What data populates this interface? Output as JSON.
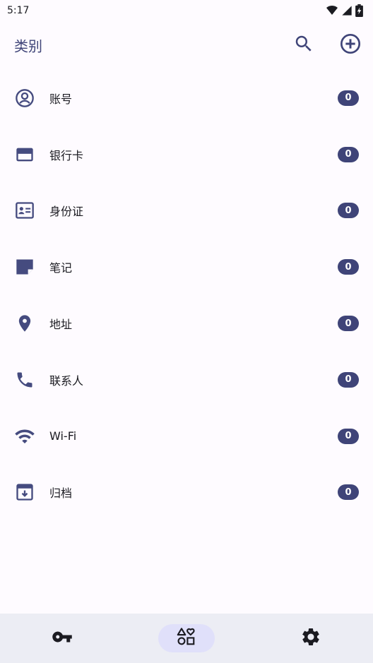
{
  "status_bar": {
    "time": "5:17",
    "icons": [
      "wifi-icon",
      "cellular-signal-icon",
      "battery-charging-icon"
    ]
  },
  "header": {
    "title": "类别",
    "actions": [
      "search-icon",
      "add-circle-icon"
    ]
  },
  "categories": [
    {
      "label": "账号",
      "count": "0",
      "icon": "account-circle-icon"
    },
    {
      "label": "银行卡",
      "count": "0",
      "icon": "credit-card-icon"
    },
    {
      "label": "身份证",
      "count": "0",
      "icon": "id-card-icon"
    },
    {
      "label": "笔记",
      "count": "0",
      "icon": "note-icon"
    },
    {
      "label": "地址",
      "count": "0",
      "icon": "location-pin-icon"
    },
    {
      "label": "联系人",
      "count": "0",
      "icon": "phone-icon"
    },
    {
      "label": "Wi-Fi",
      "count": "0",
      "icon": "wifi-icon"
    },
    {
      "label": "归档",
      "count": "0",
      "icon": "archive-icon"
    }
  ],
  "bottom_nav": {
    "items": [
      {
        "icon": "key-icon",
        "active": false
      },
      {
        "icon": "categories-icon",
        "active": true
      },
      {
        "icon": "settings-gear-icon",
        "active": false
      }
    ]
  },
  "colors": {
    "accent": "#3f4478",
    "background": "#fefbff",
    "nav_background": "#ecedf4",
    "nav_active": "#e0e0fa",
    "icon": "#454b7f"
  }
}
